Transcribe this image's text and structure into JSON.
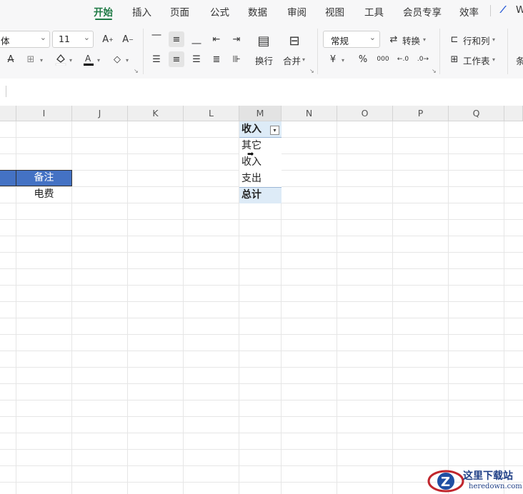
{
  "menu": {
    "tabs": [
      "开始",
      "插入",
      "页面",
      "公式",
      "数据",
      "审阅",
      "视图",
      "工具",
      "会员专享",
      "效率"
    ],
    "active_tab": "开始",
    "wps_ai_fragment": "W"
  },
  "ribbon": {
    "font_name": "宋体",
    "font_name_visible": "体",
    "font_size": "11",
    "wrap_label": "换行",
    "merge_label": "合并",
    "number_format": "常规",
    "convert_label": "转换",
    "rowcol_label": "行和列",
    "sheet_label": "工作表",
    "percent_symbol": "%",
    "currency_symbol": "¥",
    "thousands_symbol": "000",
    "fill_color": "#FFFFFF",
    "font_color": "#000000"
  },
  "sheet": {
    "columns": [
      "I",
      "J",
      "K",
      "L",
      "M",
      "N",
      "O",
      "P",
      "Q"
    ],
    "header_cell": "备注",
    "header_fill": "#4472C4",
    "data_cell": "电费",
    "pivot": {
      "field_header": "收入",
      "items": [
        "其它",
        "收入",
        "支出"
      ],
      "total_label": "总计",
      "header_fill": "#DDEBF7"
    }
  },
  "watermark": {
    "title": "这里下载站",
    "url": "heredown.com"
  }
}
